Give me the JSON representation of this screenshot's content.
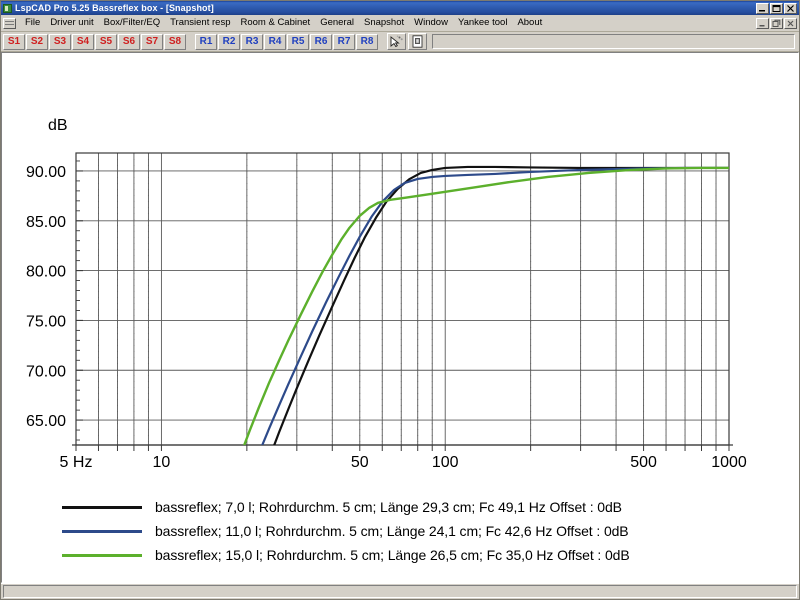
{
  "window": {
    "title": "LspCAD Pro 5.25 Bassreflex box - [Snapshot]",
    "app_icon": "lspcad-app-icon",
    "controls": [
      {
        "name": "minimize-button",
        "glyph": "minimize-icon"
      },
      {
        "name": "maximize-button",
        "glyph": "maximize-icon"
      },
      {
        "name": "close-button",
        "glyph": "close-icon"
      }
    ],
    "mdi_controls": [
      {
        "name": "mdi-minimize-button",
        "glyph": "minimize-icon"
      },
      {
        "name": "mdi-restore-button",
        "glyph": "restore-icon"
      },
      {
        "name": "mdi-close-button",
        "glyph": "close-icon"
      }
    ]
  },
  "menu": {
    "system_icon": "mdi-system-menu-icon",
    "items": [
      {
        "label": "File"
      },
      {
        "label": "Driver unit"
      },
      {
        "label": "Box/Filter/EQ"
      },
      {
        "label": "Transient resp"
      },
      {
        "label": "Room & Cabinet"
      },
      {
        "label": "General"
      },
      {
        "label": "Snapshot"
      },
      {
        "label": "Window"
      },
      {
        "label": "Yankee tool"
      },
      {
        "label": "About"
      }
    ]
  },
  "toolbar": {
    "snapshot_buttons": [
      "S1",
      "S2",
      "S3",
      "S4",
      "S5",
      "S6",
      "S7",
      "S8"
    ],
    "reference_buttons": [
      "R1",
      "R2",
      "R3",
      "R4",
      "R5",
      "R6",
      "R7",
      "R8"
    ],
    "icon_buttons": [
      {
        "name": "cursor-tool-icon"
      },
      {
        "name": "print-preview-icon"
      }
    ],
    "text_field_value": "",
    "text_field_placeholder": ""
  },
  "statusbar": {
    "text": ""
  },
  "colors": {
    "series_1": "#111111",
    "series_2": "#2d4a8a",
    "series_3": "#5cb02c",
    "grid_major": "#666666",
    "grid_minor": "#9a9a9a",
    "axis": "#333333",
    "title_bar": "#2f5bb0",
    "face": "#d4d0c8"
  },
  "chart_data": {
    "type": "line",
    "title": "",
    "ylabel": "dB",
    "xlabel": "",
    "xscale": "log",
    "xlim": [
      5,
      1000
    ],
    "ylim": [
      62.5,
      91.8
    ],
    "grid": true,
    "legend_position": "below",
    "yticks": [
      "90.00",
      "85.00",
      "80.00",
      "75.00",
      "70.00",
      "65.00"
    ],
    "ytick_values": [
      90,
      85,
      80,
      75,
      70,
      65
    ],
    "xticks": [
      "5 Hz",
      "10",
      "50",
      "100",
      "500",
      "1000"
    ],
    "xtick_values": [
      5,
      10,
      50,
      100,
      500,
      1000
    ],
    "series": [
      {
        "name": "bassreflex; 7,0 l; Rohrdurchm. 5 cm; Länge 29,3 cm; Fc 49,1 Hz",
        "offset_label": "Offset : 0dB",
        "color": "#111111",
        "volume_l": "7,0",
        "port_diameter_cm": "5",
        "port_length_cm": "29,3",
        "fc_hz": "49,1",
        "points": [
          [
            20,
            55.0
          ],
          [
            22,
            58.4
          ],
          [
            24,
            61.2
          ],
          [
            26,
            63.8
          ],
          [
            28,
            66.1
          ],
          [
            30,
            68.2
          ],
          [
            33,
            71.0
          ],
          [
            36,
            73.5
          ],
          [
            40,
            76.4
          ],
          [
            44,
            79.0
          ],
          [
            48,
            81.3
          ],
          [
            52,
            83.3
          ],
          [
            57,
            85.3
          ],
          [
            62,
            86.9
          ],
          [
            68,
            88.2
          ],
          [
            75,
            89.2
          ],
          [
            82,
            89.8
          ],
          [
            90,
            90.1
          ],
          [
            100,
            90.3
          ],
          [
            120,
            90.4
          ],
          [
            150,
            90.4
          ],
          [
            200,
            90.35
          ],
          [
            300,
            90.3
          ],
          [
            500,
            90.3
          ],
          [
            700,
            90.3
          ],
          [
            1000,
            90.3
          ]
        ]
      },
      {
        "name": "bassreflex; 11,0 l; Rohrdurchm. 5 cm; Länge 24,1 cm; Fc 42,6 Hz",
        "offset_label": "Offset : 0dB",
        "color": "#2d4a8a",
        "volume_l": "11,0",
        "port_diameter_cm": "5",
        "port_length_cm": "24,1",
        "fc_hz": "42,6",
        "points": [
          [
            18,
            55.0
          ],
          [
            20,
            58.6
          ],
          [
            22,
            61.6
          ],
          [
            24,
            64.2
          ],
          [
            26,
            66.5
          ],
          [
            28,
            68.6
          ],
          [
            31,
            71.4
          ],
          [
            34,
            73.9
          ],
          [
            38,
            76.8
          ],
          [
            42,
            79.3
          ],
          [
            46,
            81.5
          ],
          [
            50,
            83.4
          ],
          [
            55,
            85.4
          ],
          [
            60,
            86.9
          ],
          [
            66,
            88.1
          ],
          [
            72,
            88.8
          ],
          [
            80,
            89.2
          ],
          [
            90,
            89.4
          ],
          [
            100,
            89.5
          ],
          [
            120,
            89.6
          ],
          [
            150,
            89.7
          ],
          [
            200,
            89.9
          ],
          [
            300,
            90.1
          ],
          [
            500,
            90.25
          ],
          [
            700,
            90.3
          ],
          [
            1000,
            90.3
          ]
        ]
      },
      {
        "name": "bassreflex; 15,0 l; Rohrdurchm. 5 cm; Länge 26,5 cm; Fc 35,0 Hz",
        "offset_label": "Offset : 0dB",
        "color": "#5cb02c",
        "volume_l": "15,0",
        "port_diameter_cm": "5",
        "port_length_cm": "26,5",
        "fc_hz": "35,0",
        "points": [
          [
            16,
            55.0
          ],
          [
            17.5,
            58.5
          ],
          [
            19,
            61.5
          ],
          [
            20.5,
            64.0
          ],
          [
            22,
            66.2
          ],
          [
            24,
            68.8
          ],
          [
            26,
            71.0
          ],
          [
            28,
            73.0
          ],
          [
            31,
            75.6
          ],
          [
            34,
            77.9
          ],
          [
            37,
            79.9
          ],
          [
            40,
            81.6
          ],
          [
            43,
            83.1
          ],
          [
            46,
            84.3
          ],
          [
            50,
            85.5
          ],
          [
            54,
            86.3
          ],
          [
            58,
            86.8
          ],
          [
            64,
            87.1
          ],
          [
            72,
            87.3
          ],
          [
            85,
            87.6
          ],
          [
            100,
            87.9
          ],
          [
            130,
            88.4
          ],
          [
            170,
            88.9
          ],
          [
            230,
            89.4
          ],
          [
            320,
            89.8
          ],
          [
            450,
            90.1
          ],
          [
            600,
            90.25
          ],
          [
            800,
            90.3
          ],
          [
            1000,
            90.3
          ]
        ]
      }
    ]
  }
}
